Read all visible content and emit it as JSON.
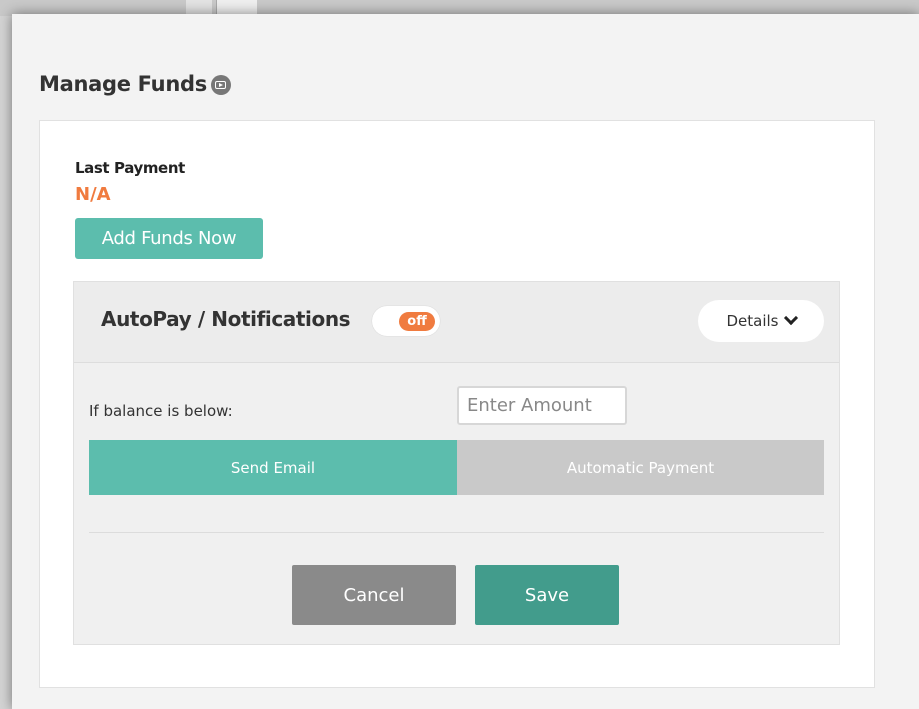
{
  "modal": {
    "title": "Manage Funds",
    "title_icon": "video-icon"
  },
  "last_payment": {
    "label": "Last Payment",
    "value": "N/A"
  },
  "add_funds_label": "Add Funds Now",
  "autopay": {
    "title": "AutoPay / Notifications",
    "toggle_label": "off",
    "details_label": "Details",
    "details_icon": "chevron-down-icon",
    "balance_label": "If balance is below:",
    "amount_placeholder": "Enter Amount",
    "segment": {
      "email_label": "Send Email",
      "auto_label": "Automatic Payment",
      "selected": "Send Email"
    },
    "cancel_label": "Cancel",
    "save_label": "Save"
  },
  "colors": {
    "accent_teal": "#5cbdad",
    "save_teal": "#429c8c",
    "orange": "#f07b3f",
    "cancel_gray": "#8a8a8a"
  }
}
